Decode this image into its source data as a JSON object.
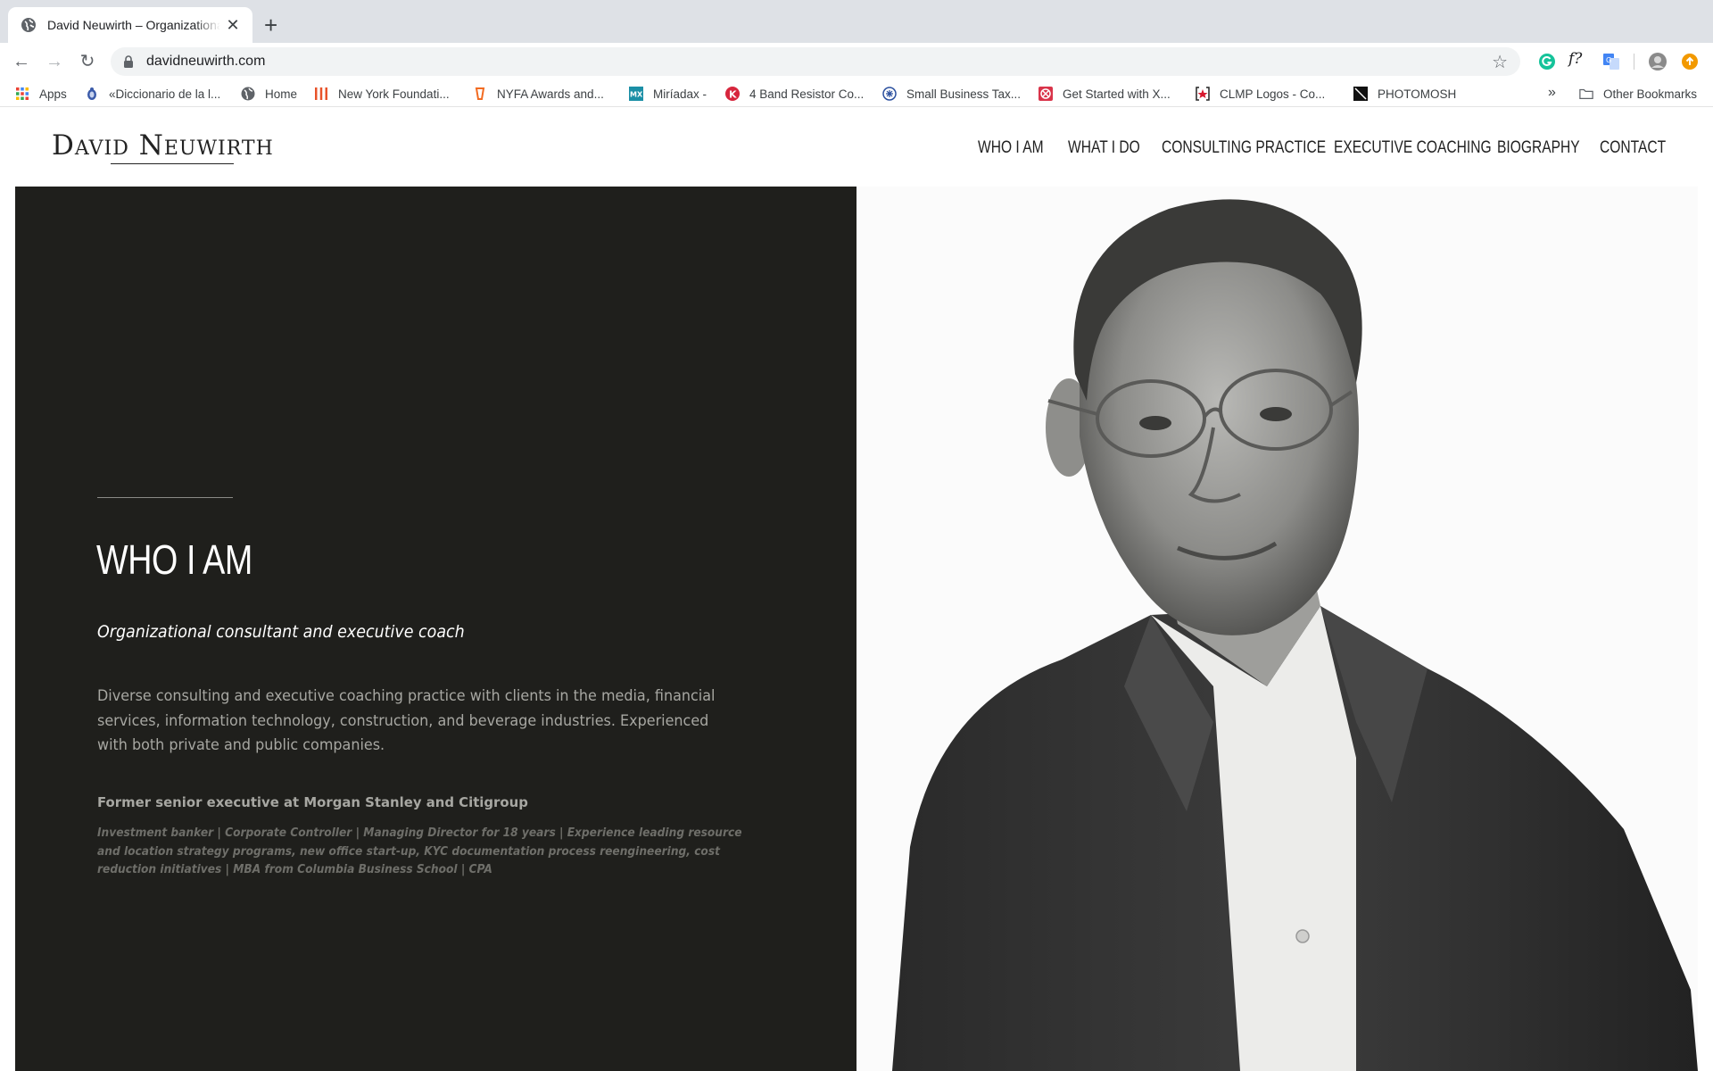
{
  "browser": {
    "tab_title": "David Neuwirth – Organizational",
    "url": "davidneuwirth.com",
    "bookmarks": [
      {
        "label": "Apps",
        "icon": "apps-grid-icon"
      },
      {
        "label": "«Diccionario de la l...",
        "icon": "rae-icon"
      },
      {
        "label": "Home",
        "icon": "globe-icon"
      },
      {
        "label": "New York Foundati...",
        "icon": "nyfa-icon"
      },
      {
        "label": "NYFA Awards and...",
        "icon": "submittable-icon"
      },
      {
        "label": "Miríadax -",
        "icon": "miriadax-icon"
      },
      {
        "label": "4 Band Resistor Co...",
        "icon": "k-icon"
      },
      {
        "label": "Small Business Tax...",
        "icon": "irs-icon"
      },
      {
        "label": "Get Started with X...",
        "icon": "xero-icon"
      },
      {
        "label": "CLMP Logos - Co...",
        "icon": "clmp-icon"
      },
      {
        "label": "PHOTOMOSH",
        "icon": "photomosh-icon"
      }
    ],
    "more_bookmarks": "»",
    "other_bookmarks": "Other Bookmarks",
    "extensions_text": "f?"
  },
  "site": {
    "logo": "David Neuwirth",
    "nav": [
      "WHO I AM",
      "WHAT I DO",
      "CONSULTING PRACTICE",
      "EXECUTIVE COACHING",
      "BIOGRAPHY",
      "CONTACT"
    ],
    "hero": {
      "title": "WHO I AM",
      "subtitle": "Organizational consultant and executive coach",
      "description": "Diverse consulting and executive coaching practice with clients in the media, financial services, information technology, construction, and beverage industries. Experienced with both private and public companies.",
      "former": "Former senior executive at Morgan Stanley and Citigroup",
      "details": "Investment banker | Corporate Controller | Managing Director for 18 years | Experience leading resource and location strategy programs, new office start-up, KYC documentation process reengineering, cost reduction initiatives | MBA from Columbia Business School | CPA"
    }
  },
  "colors": {
    "dark_panel": "#1f1f1c",
    "chrome_tabstrip": "#dee1e6"
  }
}
